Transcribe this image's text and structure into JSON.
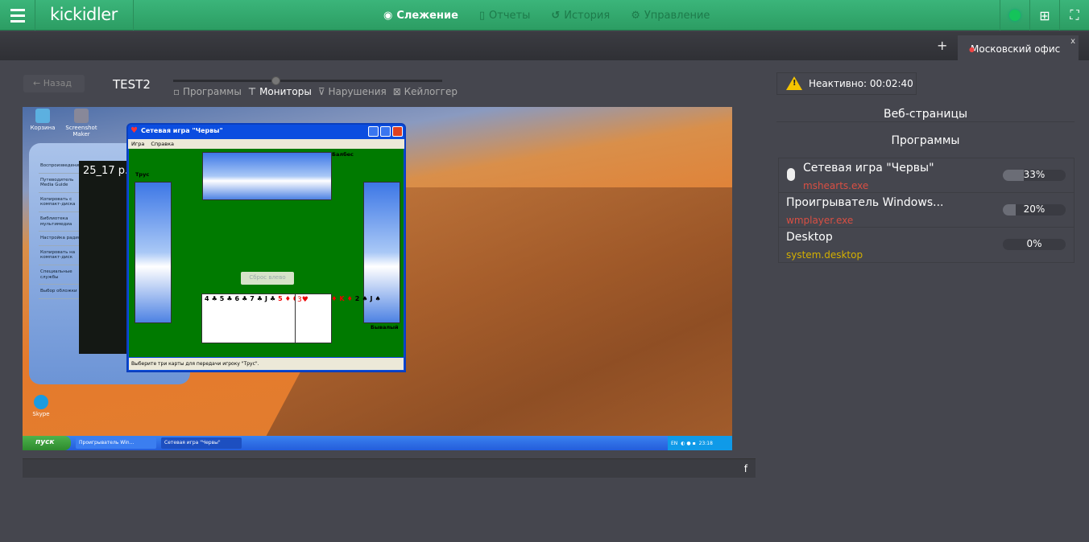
{
  "header": {
    "logo": "kickidler",
    "nav": [
      {
        "label": "Слежение",
        "icon": "eye-icon",
        "active": true
      },
      {
        "label": "Отчеты",
        "icon": "report-icon",
        "active": false
      },
      {
        "label": "История",
        "icon": "history-icon",
        "active": false
      },
      {
        "label": "Управление",
        "icon": "gear-icon",
        "active": false
      }
    ],
    "status_color": "#14c45a"
  },
  "tabs": {
    "add": "+",
    "items": [
      {
        "label": "Московский офис",
        "close": "x"
      }
    ]
  },
  "toolbar": {
    "back": "← Назад",
    "user": "TEST2",
    "views": [
      {
        "label": "Программы",
        "icon": "window-icon",
        "active": false
      },
      {
        "label": "Мониторы",
        "icon": "monitor-icon",
        "active": true
      },
      {
        "label": "Нарушения",
        "icon": "filter-icon",
        "active": false
      },
      {
        "label": "Кейлоггер",
        "icon": "keyboard-icon",
        "active": false
      }
    ]
  },
  "screenshot": {
    "desktop_icons": [
      "Корзина",
      "Screenshot Maker",
      "Skype"
    ],
    "wmp": {
      "menu": [
        "Воспроизведение",
        "Путеводитель Media Guide",
        "Копировать с компакт-диска",
        "Библиотека мультимедиа",
        "Настройка радио",
        "Копировать на компакт-диск",
        "Специальные службы",
        "Выбор обложки"
      ],
      "video_title": "25_17 p.u"
    },
    "hearts": {
      "title": "Сетевая игра \"Червы\"",
      "menu": [
        "Игра",
        "Справка"
      ],
      "players": {
        "left": "Трус",
        "top": "Балбес",
        "right": "Бывалый"
      },
      "pass_button": "Сброс влево",
      "hand": [
        "4♣",
        "5♣",
        "6♣",
        "7♣",
        "J♣",
        "5♦",
        "6♦",
        "9♦",
        "Q♦",
        "K♦",
        "2♠",
        "J♠",
        "3♥"
      ],
      "status": "Выберите три карты для передачи игроку \"Трус\"."
    },
    "taskbar": {
      "start": "пуск",
      "items": [
        "Проигрыватель Win...",
        "Сетевая игра \"Червы\""
      ],
      "lang": "EN",
      "time": "23:18"
    }
  },
  "footer": {
    "icon": "f"
  },
  "side": {
    "inactive": "Неактивно: 00:02:40",
    "web_title": "Веб-страницы",
    "programs_title": "Программы",
    "programs": [
      {
        "name": "Сетевая игра \"Червы\"",
        "exe": "mshearts.exe",
        "percent": 33,
        "percent_label": "33%",
        "exe_color": "#d94f43",
        "active": true
      },
      {
        "name": "Проигрыватель Windows...",
        "exe": "wmplayer.exe",
        "percent": 20,
        "percent_label": "20%",
        "exe_color": "#d94f43",
        "active": false
      },
      {
        "name": "Desktop",
        "exe": "system.desktop",
        "percent": 0,
        "percent_label": "0%",
        "exe_color": "#d4b000",
        "active": false
      }
    ]
  }
}
